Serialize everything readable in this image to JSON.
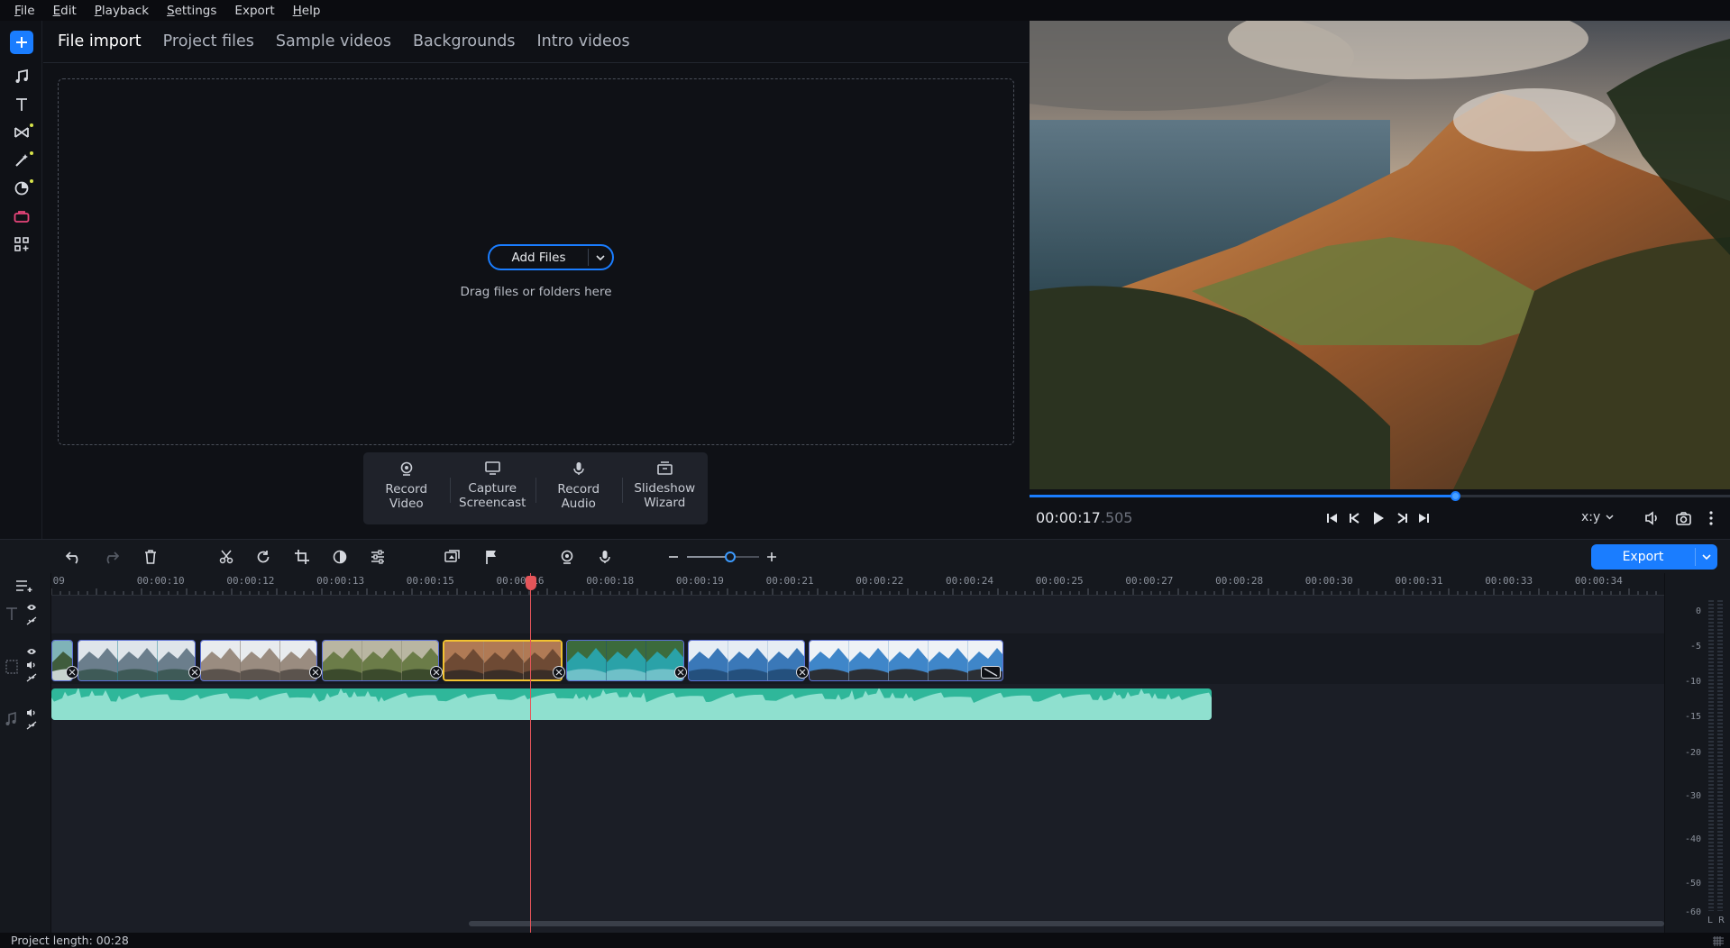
{
  "menu": [
    {
      "underline": "F",
      "rest": "ile"
    },
    {
      "underline": "E",
      "rest": "dit"
    },
    {
      "underline": "P",
      "rest": "layback"
    },
    {
      "underline": "S",
      "rest": "ettings"
    },
    {
      "underline": "",
      "rest": "Export"
    },
    {
      "underline": "H",
      "rest": "elp"
    }
  ],
  "tools": [
    "add-media",
    "music",
    "titles",
    "transitions",
    "effects",
    "filters",
    "stickers",
    "more-tools"
  ],
  "import": {
    "tabs": [
      "File import",
      "Project files",
      "Sample videos",
      "Backgrounds",
      "Intro videos"
    ],
    "active_tab": "File import",
    "add_files_label": "Add Files",
    "drag_hint": "Drag files or folders here",
    "record_buttons": [
      {
        "label": "Record\nVideo",
        "icon": "webcam-icon"
      },
      {
        "label": "Capture\nScreencast",
        "icon": "monitor-icon"
      },
      {
        "label": "Record\nAudio",
        "icon": "microphone-icon"
      },
      {
        "label": "Slideshow\nWizard",
        "icon": "slideshow-icon"
      }
    ]
  },
  "player": {
    "timecode_main": "00:00:17",
    "timecode_ms": ".505",
    "progress": 0.607,
    "aspect_label": "x:y"
  },
  "toolbar": {
    "export_label": "Export",
    "zoom_level": 0.6
  },
  "timeline": {
    "ruler_labels": [
      ":09",
      "00:00:10",
      "00:00:12",
      "00:00:13",
      "00:00:15",
      "00:00:16",
      "00:00:18",
      "00:00:19",
      "00:00:21",
      "00:00:22",
      "00:00:24",
      "00:00:25",
      "00:00:27",
      "00:00:28",
      "00:00:30",
      "00:00:31",
      "00:00:33",
      "00:00:34"
    ],
    "playhead_time": "00:00:17.505",
    "clips": [
      {
        "scene": "waterfall",
        "selected": false
      },
      {
        "scene": "glacier",
        "selected": false
      },
      {
        "scene": "snowy-ridge",
        "selected": false
      },
      {
        "scene": "green-valley",
        "selected": false
      },
      {
        "scene": "canyon-sunset",
        "selected": true
      },
      {
        "scene": "alpine-lake",
        "selected": false
      },
      {
        "scene": "snow-peaks",
        "selected": false
      },
      {
        "scene": "bridge",
        "selected": false
      }
    ]
  },
  "vu_meter": {
    "labels": [
      "0",
      "-5",
      "-10",
      "-15",
      "-20",
      "-30",
      "-40",
      "-50",
      "-60"
    ],
    "channels": [
      "L",
      "R"
    ]
  },
  "status": {
    "project_length": "Project length: 00:28"
  },
  "colors": {
    "accent": "#1a7dff",
    "selected_clip": "#f2c230",
    "audio": "#2fb79a",
    "playhead": "#e4555a"
  }
}
